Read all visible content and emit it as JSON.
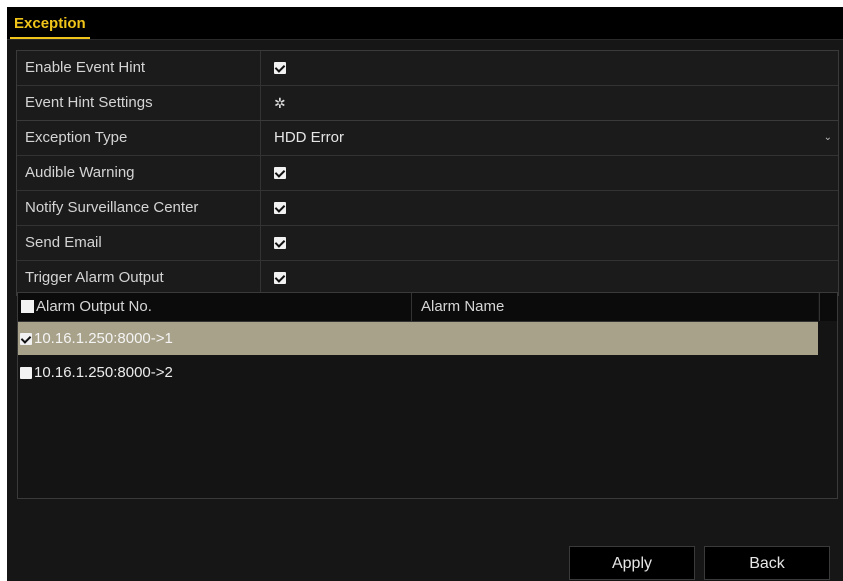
{
  "window": {
    "title": "Exception"
  },
  "event_hint": {
    "enable_label": "Enable Event Hint",
    "enable_checked": true,
    "settings_label": "Event Hint Settings",
    "settings_icon": "gear-icon"
  },
  "exception": {
    "type_label": "Exception Type",
    "type_value": "HDD Error",
    "options": [
      {
        "label": "Audible Warning",
        "checked": true
      },
      {
        "label": "Notify Surveillance Center",
        "checked": true
      },
      {
        "label": "Send Email",
        "checked": true
      },
      {
        "label": "Trigger Alarm Output",
        "checked": true
      }
    ]
  },
  "alarm_table": {
    "columns": [
      "Alarm Output No.",
      "Alarm Name"
    ],
    "header_checked": false,
    "rows": [
      {
        "output": "10.16.1.250:8000->1",
        "name": "",
        "checked": true,
        "selected": true
      },
      {
        "output": "10.16.1.250:8000->2",
        "name": "",
        "checked": false,
        "selected": false
      }
    ]
  },
  "buttons": {
    "apply": "Apply",
    "back": "Back"
  },
  "colors": {
    "accent": "#f0c419",
    "selected_row": "#a8a28a",
    "background": "#161616"
  }
}
